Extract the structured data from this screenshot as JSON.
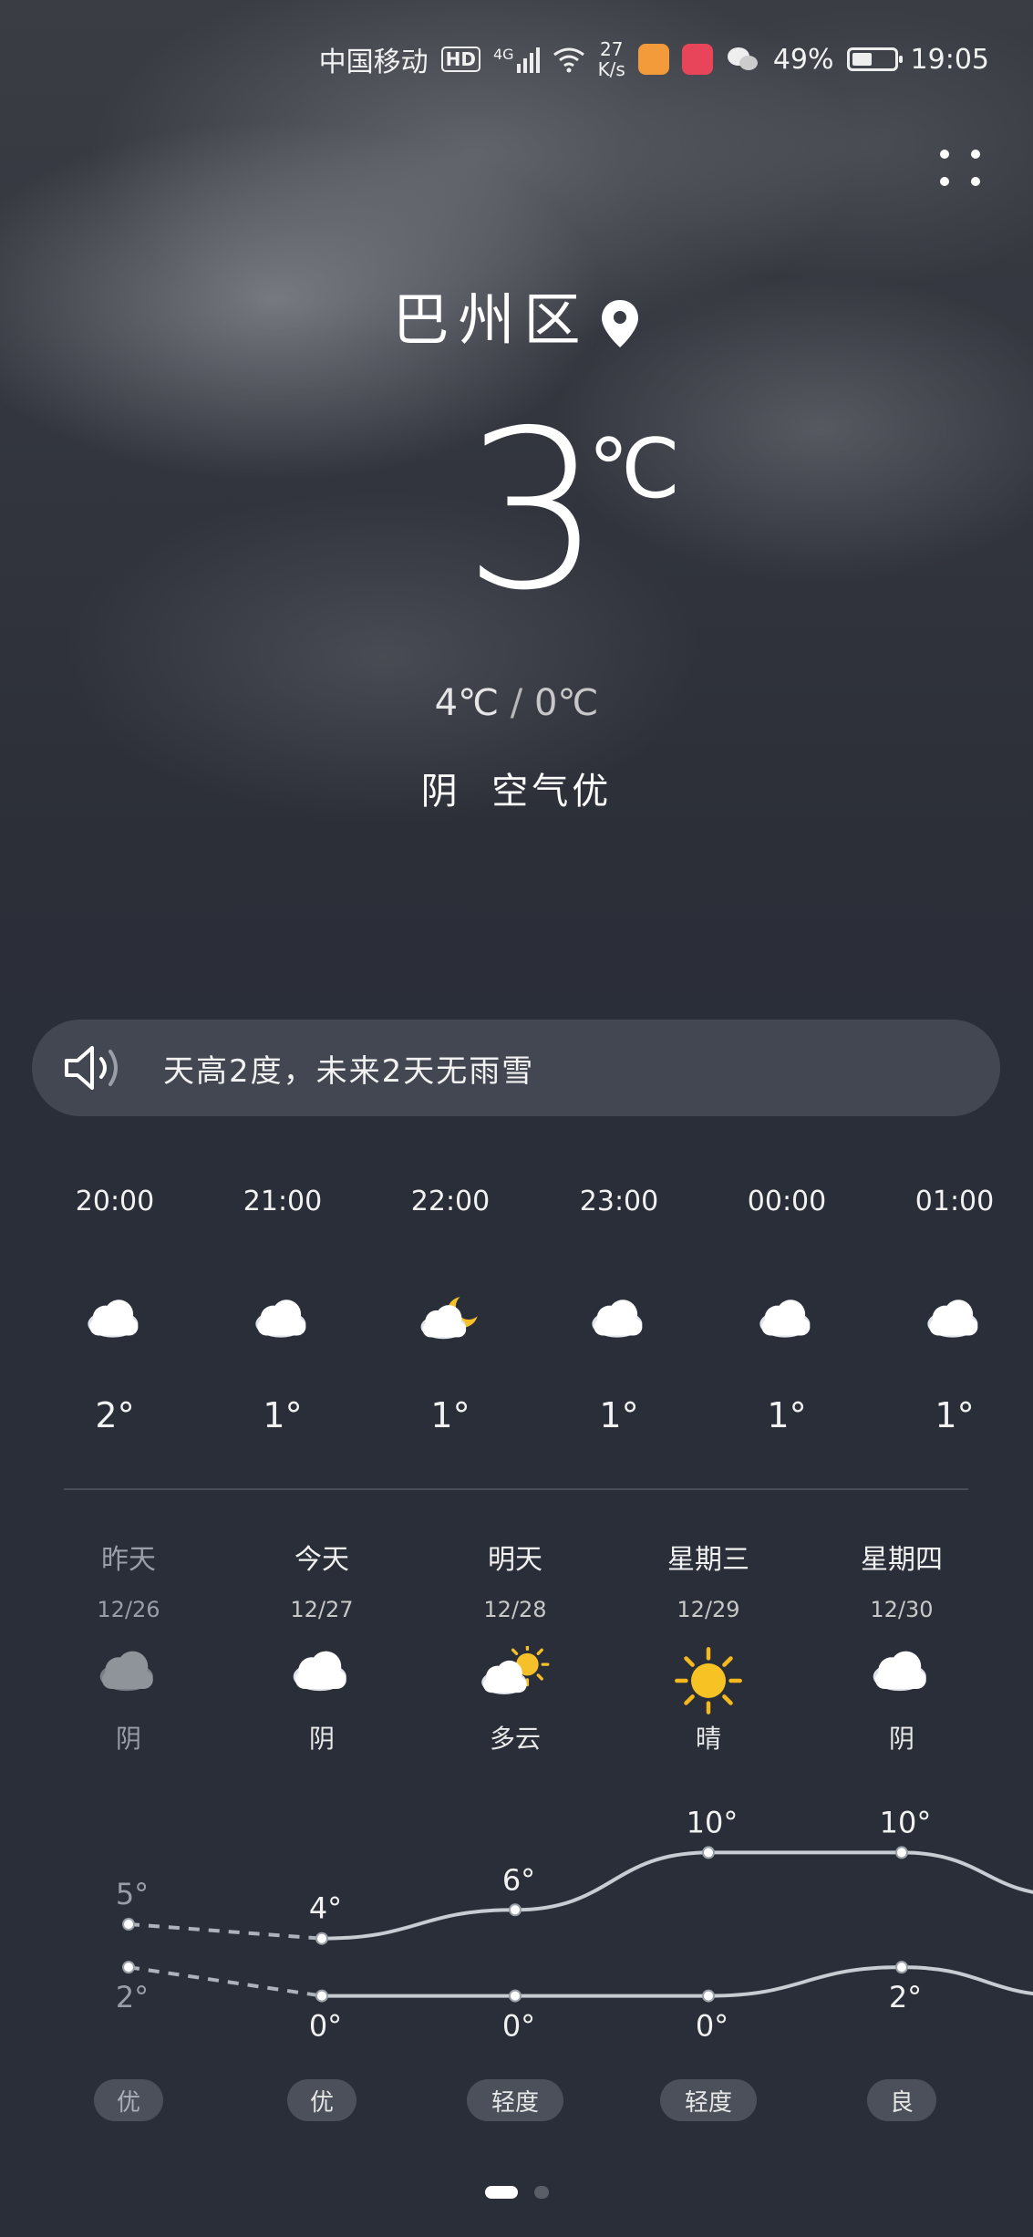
{
  "status_bar": {
    "carrier": "中国移动",
    "hd": "HD",
    "network": "4G",
    "speed_value": "27",
    "speed_unit": "K/s",
    "battery": "49%",
    "battery_fraction": 0.49,
    "time": "19:05"
  },
  "location": {
    "city": "巴州区"
  },
  "current": {
    "temp": "3",
    "unit": "℃",
    "high": "4℃",
    "sep": "/",
    "low": "0℃",
    "condition": "阴",
    "air": "空气优"
  },
  "notice": {
    "text": "天高2度，未来2天无雨雪"
  },
  "hourly": [
    {
      "time": "20:00",
      "icon": "cloud-icon",
      "temp": "2°"
    },
    {
      "time": "21:00",
      "icon": "cloud-icon",
      "temp": "1°"
    },
    {
      "time": "22:00",
      "icon": "moon-cloud-icon",
      "temp": "1°"
    },
    {
      "time": "23:00",
      "icon": "cloud-icon",
      "temp": "1°"
    },
    {
      "time": "00:00",
      "icon": "cloud-icon",
      "temp": "1°"
    },
    {
      "time": "01:00",
      "icon": "cloud-icon",
      "temp": "1°"
    }
  ],
  "daily": [
    {
      "name": "昨天",
      "date": "12/26",
      "icon": "cloud-icon",
      "cond": "阴",
      "high": "5°",
      "low": "2°",
      "aqi": "优"
    },
    {
      "name": "今天",
      "date": "12/27",
      "icon": "cloud-icon",
      "cond": "阴",
      "high": "4°",
      "low": "0°",
      "aqi": "优"
    },
    {
      "name": "明天",
      "date": "12/28",
      "icon": "partly-cloudy-icon",
      "cond": "多云",
      "high": "6°",
      "low": "0°",
      "aqi": "轻度"
    },
    {
      "name": "星期三",
      "date": "12/29",
      "icon": "sun-icon",
      "cond": "晴",
      "high": "10°",
      "low": "0°",
      "aqi": "轻度"
    },
    {
      "name": "星期四",
      "date": "12/30",
      "icon": "cloud-icon",
      "cond": "阴",
      "high": "10°",
      "low": "2°",
      "aqi": "良"
    }
  ],
  "chart_data": {
    "type": "line",
    "categories": [
      "12/26",
      "12/27",
      "12/28",
      "12/29",
      "12/30"
    ],
    "series": [
      {
        "values": [
          5,
          4,
          6,
          10,
          10
        ]
      },
      {
        "values": [
          2,
          0,
          0,
          0,
          2
        ]
      }
    ]
  },
  "pager": {
    "count": 2,
    "active": 0
  }
}
